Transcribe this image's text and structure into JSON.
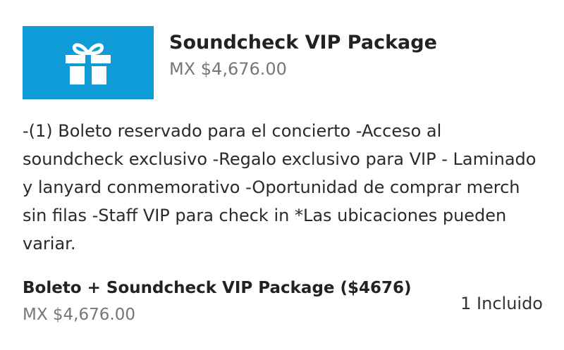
{
  "package": {
    "icon": "gift-icon",
    "thumb_color": "#0f9ad8",
    "title": "Soundcheck VIP Package",
    "price": "MX $4,676.00",
    "description": "-(1) Boleto reservado para el concierto -Acceso al soundcheck exclusivo -Regalo exclusivo para VIP - Laminado y lanyard conmemorativo -Oportunidad de comprar merch sin filas -Staff VIP para check in *Las ubicaciones pueden variar."
  },
  "ticket": {
    "name": "Boleto + Soundcheck VIP Package ($4676)",
    "price": "MX $4,676.00",
    "quantity_label": "1 Incluido"
  }
}
